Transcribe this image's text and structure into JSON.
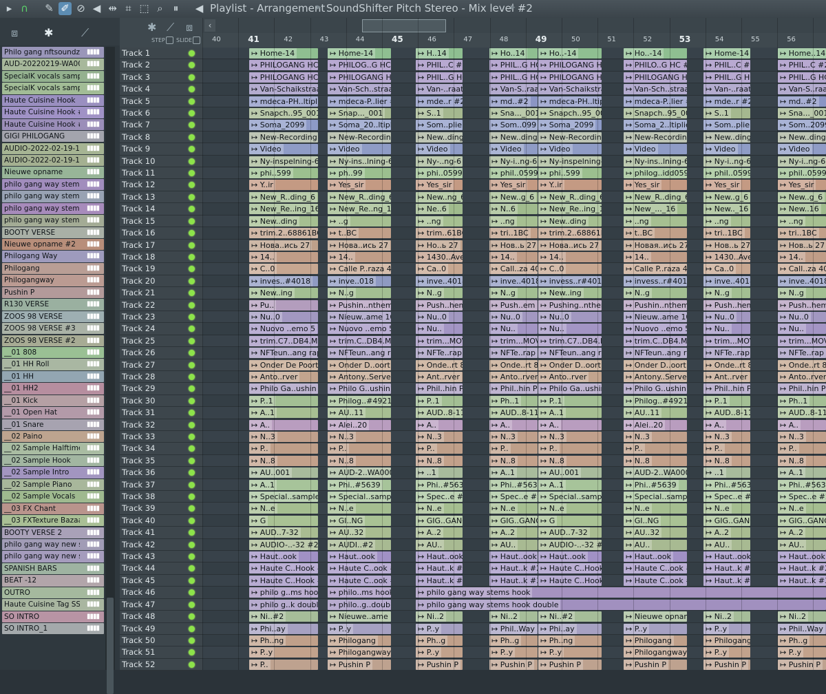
{
  "window": {
    "title": "Playlist - Arrangement",
    "breadcrumb": "SoundShifter Pitch Stereo - Mix level #2"
  },
  "toolbar": {
    "icons": [
      "magnet-icon",
      "pencil-icon",
      "paint-brush-icon",
      "delete-icon",
      "mute-icon",
      "slip-icon",
      "slice-icon",
      "select-icon",
      "zoom-icon",
      "playback-icon"
    ],
    "step_label": "STEP",
    "slide_label": "SLIDE"
  },
  "ruler": {
    "bars": [
      "40",
      "41",
      "42",
      "43",
      "44",
      "45",
      "46",
      "47",
      "48",
      "49",
      "50",
      "51",
      "52",
      "53",
      "54",
      "55",
      "56"
    ]
  },
  "clips": [
    {
      "name": "Philo gang nftsoundz#..",
      "color": "#9a96b9"
    },
    {
      "name": "AUD-20220219-WA0001",
      "color": "#a7b89b"
    },
    {
      "name": "SpecialK vocals sample",
      "color": "#94b18f"
    },
    {
      "name": "SpecialK vocals sample..",
      "color": "#a2bc96"
    },
    {
      "name": "Haute Cuisine Hook",
      "color": "#9a8fc0"
    },
    {
      "name": "Haute Cuisine Hook #2",
      "color": "#a092c6"
    },
    {
      "name": "Haute Cuisine Hook #3",
      "color": "#9b8eb9"
    },
    {
      "name": "GIGI PHILOGANG",
      "color": "#a3a4ad"
    },
    {
      "name": "AUDIO-2022-02-19-11..",
      "color": "#a6b493"
    },
    {
      "name": "AUDIO-2022-02-19-11..",
      "color": "#a4b091"
    },
    {
      "name": "Nieuwe opname",
      "color": "#98b598"
    },
    {
      "name": "philo gang way stems..",
      "color": "#a18dbd"
    },
    {
      "name": "philo gang way stems..",
      "color": "#98a2b3"
    },
    {
      "name": "philo gang way stems..",
      "color": "#a78bbb"
    },
    {
      "name": "philo gang way stems..",
      "color": "#a3ab95"
    },
    {
      "name": "BOOTY VERSE",
      "color": "#a9b0a6"
    },
    {
      "name": "Nieuwe opname #2",
      "color": "#b88e7a"
    },
    {
      "name": "Philogang Way",
      "color": "#9e9bbd"
    },
    {
      "name": "Philogang",
      "color": "#b99e95"
    },
    {
      "name": "Philogangway",
      "color": "#bb9b92"
    },
    {
      "name": "Pushin P",
      "color": "#b39a9a"
    },
    {
      "name": "R130 VERSE",
      "color": "#9ab0a0"
    },
    {
      "name": "ZOOS 98 VERSE",
      "color": "#9eafb2"
    },
    {
      "name": "ZOOS 98 VERSE #3",
      "color": "#aab2a6"
    },
    {
      "name": "ZOOS 98 VERSE #2",
      "color": "#a7ab94"
    },
    {
      "name": "__01 808",
      "color": "#9ac094"
    },
    {
      "name": "__01 HH Roll",
      "color": "#a9b7a2"
    },
    {
      "name": "__01 HH",
      "color": "#93a6b2"
    },
    {
      "name": "__01 HH2",
      "color": "#b68e9f"
    },
    {
      "name": "__01 Kick",
      "color": "#b5a0a4"
    },
    {
      "name": "__01 Open Hat",
      "color": "#b39aa9"
    },
    {
      "name": "__01 Snare",
      "color": "#a7a3b0"
    },
    {
      "name": "__02 Paino",
      "color": "#bda48f"
    },
    {
      "name": "__02 Sample Halftime",
      "color": "#a9bca2"
    },
    {
      "name": "__02 Sample Hook",
      "color": "#a2b6a1"
    },
    {
      "name": "__02 Sample Intro",
      "color": "#a295c0"
    },
    {
      "name": "__02 Sample Piano",
      "color": "#a8b79b"
    },
    {
      "name": "__02 Sample Vocals",
      "color": "#9fb98f"
    },
    {
      "name": "__03 FX Chant",
      "color": "#b9948c"
    },
    {
      "name": "__03 FXTexture Bazaar",
      "color": "#a9bf95"
    },
    {
      "name": "BOOTY VERSE 2",
      "color": "#a9a1b8"
    },
    {
      "name": "philo gang way new st..",
      "color": "#a19cb6"
    },
    {
      "name": "philo gang way new st..",
      "color": "#a59cbd"
    },
    {
      "name": "SPANISH BARS",
      "color": "#9eb3a1"
    },
    {
      "name": "BEAT -12",
      "color": "#b2a5aa"
    },
    {
      "name": "OUTRO",
      "color": "#a5b99e"
    },
    {
      "name": "Haute Cuisine Tag SSL",
      "color": "#a9b6a0"
    },
    {
      "name": "SO INTRO",
      "color": "#b894a4"
    },
    {
      "name": "SO INTRO_1",
      "color": "#a4a9ab"
    }
  ],
  "tracks": [
    {
      "name": "Track 1",
      "color": "#8fbf91",
      "labels": [
        "Home-14",
        "Home-14",
        "H..14",
        "Ho..14",
        "Ho..-14",
        "Ho..-14",
        "Home-14",
        "Home..14"
      ]
    },
    {
      "name": "Track 2",
      "color": "#a08cc2",
      "labels": [
        "PHILOGANG HC #2",
        "PHILOG..G HC #2",
        "PHIL..C #2",
        "PHIL..G HC #2",
        "PHILOGANG HC #2",
        "PHILO..G HC #2",
        "PHIL..C #2",
        "PHIL..C #2"
      ]
    },
    {
      "name": "Track 3",
      "color": "#9f8dc0",
      "labels": [
        "PHILOGANG HC",
        "PHILOGANG HC",
        "PHIL..G HC",
        "PHIL..G HC",
        "PHILOGANG HC",
        "PHILOGANG HC",
        "PHIL..G HC",
        "PHIL..G HC"
      ]
    },
    {
      "name": "Track 4",
      "color": "#9b90bf",
      "labels": [
        "Van-Schaikstraat",
        "Van-Sch..straat",
        "Van-..raat",
        "Van-S..raat",
        "Van-Schaikstraat",
        "Van-Sch..straat",
        "Van-..raat",
        "Van-S..raat"
      ]
    },
    {
      "name": "Track 5",
      "color": "#8b95c4",
      "labels": [
        "mdeca-PH..ltiplier",
        "mdeca-P..lier #2",
        "mde..r #2",
        "md..#2",
        "mdeca-PH..ltiplier",
        "mdeca-P..lier #2",
        "mde..r #2",
        "md..#2"
      ]
    },
    {
      "name": "Track 6",
      "color": "#a5b88f",
      "labels": [
        "Snapch..95_001",
        "Snap..._001",
        "S..1",
        "Sna..._001",
        "Snapch..95_001",
        "Snapch..95_001",
        "S..1",
        "Sna..._001"
      ]
    },
    {
      "name": "Track 7",
      "color": "#8d9ac7",
      "labels": [
        "Soma_2099",
        "Soma_20..ltiplier",
        "Som..plier",
        "Som..099",
        "Soma_2099",
        "Soma_2..ltiplier",
        "Som..plier",
        "Som..2099"
      ]
    },
    {
      "name": "Track 8",
      "color": "#a8b29c",
      "labels": [
        "New-Recording",
        "New-Recording",
        "New..ding",
        "New..ding",
        "New-Recording",
        "New-Recording",
        "New..ding",
        "New..ding"
      ]
    },
    {
      "name": "Track 9",
      "color": "#8f9cc6",
      "labels": [
        "Video",
        "Video",
        "Video",
        "Video",
        "Video",
        "Video",
        "Video",
        "Video"
      ]
    },
    {
      "name": "Track 10",
      "color": "#a7b896",
      "labels": [
        "Ny-inspelning-6",
        "Ny-ins..lning-6",
        "Ny-..ng-6",
        "Ny-i..ng-6",
        "Ny-inspelning-6",
        "Ny-ins..lning-6",
        "Ny-i..ng-6",
        "Ny-i..ng-6"
      ]
    },
    {
      "name": "Track 11",
      "color": "#9cc08f",
      "labels": [
        "phi..599",
        "ph..99",
        "phi..0599",
        "phil..0599",
        "phi..599",
        "philog..idd0599",
        "phil..0599",
        "phil..0599"
      ]
    },
    {
      "name": "Track 12",
      "color": "#c49a83",
      "labels": [
        "Y..ir",
        "Yes_sir",
        "Yes_sir",
        "Yes_sir",
        "Y..ir",
        "Yes_sir",
        "Yes_sir",
        "Yes_sir"
      ]
    },
    {
      "name": "Track 13",
      "color": "#a3bd8f",
      "labels": [
        "New_R..ding_6",
        "New_R..ding_6",
        "New..ng_6",
        "New..g_6",
        "New_R..ding_6",
        "New_R..ding_6",
        "New..g_6",
        "New..g_6"
      ]
    },
    {
      "name": "Track 14",
      "color": "#a0bb8d",
      "labels": [
        "New_Re..ing_16",
        "New_Re..ng_16",
        "Ne..6",
        "N..6",
        "New_Re..ing_16",
        "New_..._16",
        "New.._16",
        "New..16"
      ]
    },
    {
      "name": "Track 15",
      "color": "#a6bf91",
      "labels": [
        "New..ding",
        "..g",
        "..ng",
        "..ng",
        "New..ding",
        "..ng",
        "..ng",
        "..ng"
      ]
    },
    {
      "name": "Track 16",
      "color": "#c2a089",
      "labels": [
        "trim.2..68861BC",
        "t..BC",
        "trim..61BC",
        "tri..1BC",
        "trim.2..68861BC",
        "t..BC",
        "tri..1BC",
        "tri..1BC"
      ]
    },
    {
      "name": "Track 17",
      "color": "#bda08a",
      "labels": [
        "Нова..ись 27",
        "Нова..ись 27",
        "Но..ь 27",
        "Нов..ь 27",
        "Нова..ись 27",
        "Новая..ись 27",
        "Нов..ь 27",
        "Нов..ь 27"
      ]
    },
    {
      "name": "Track 18",
      "color": "#c09d88",
      "labels": [
        "14..",
        "14..",
        "1430..Ave",
        "14..",
        "14..",
        "14..",
        "1430..Ave",
        "14.."
      ]
    },
    {
      "name": "Track 19",
      "color": "#c7a791",
      "labels": [
        "C..0",
        "Calle P..raza 40",
        "Ca..0",
        "Call..za 40",
        "C..0",
        "Calle P..raza 40",
        "Ca..0",
        "Call..za 40"
      ]
    },
    {
      "name": "Track 20",
      "color": "#8f9ac2",
      "labels": [
        "inves..#4018",
        "inve..018",
        "inve..4018",
        "inve..4018",
        "invess..r#4018",
        "invess..r#4018",
        "inve..4018",
        "inve..4018"
      ]
    },
    {
      "name": "Track 21",
      "color": "#a3bf92",
      "labels": [
        "New..ing",
        "N..g",
        "N..g",
        "N..g",
        "New..ing",
        "N..g",
        "N..g",
        "N..g"
      ]
    },
    {
      "name": "Track 22",
      "color": "#b39dbd",
      "labels": [
        "Pu..",
        "Pushin..nthem",
        "Push..hem",
        "Push..em",
        "Pushing..nthem",
        "Pushin..nthem",
        "Push..hem",
        "Push..hem"
      ]
    },
    {
      "name": "Track 23",
      "color": "#a298c1",
      "labels": [
        "Nu..0",
        "Nieuw..ame 10",
        "Nu..0",
        "Nu..0",
        "Nu..0",
        "Nieuw..ame 10",
        "Nu..0",
        "Nu..0"
      ]
    },
    {
      "name": "Track 24",
      "color": "#a395c4",
      "labels": [
        "Nuovo ..emo 5",
        "Nuovo ..emo 5",
        "Nu..",
        "Nu..",
        "Nu..",
        "Nuovo ..emo 5",
        "Nu..",
        "Nu.."
      ]
    },
    {
      "name": "Track 25",
      "color": "#a595c3",
      "labels": [
        "trim.C7..DB4.MOV",
        "trim.C..DB4.MOV",
        "trim...MOV",
        "trim...MOV",
        "trim.C7..DB4.MOV",
        "trim.C..DB4.MOV",
        "trim...MOV",
        "trim...MOV"
      ]
    },
    {
      "name": "Track 26",
      "color": "#a59ac0",
      "labels": [
        "NFTeun..ang rap",
        "NFTeun..ang rap",
        "NFTe..rap",
        "NFTe..rap",
        "NFTeun..ang rap",
        "NFTeun..ang rap",
        "NFTe..rap",
        "NFTe..rap"
      ]
    },
    {
      "name": "Track 27",
      "color": "#c3a48b",
      "labels": [
        "Onder De Poort 8",
        "Onder D..oort 8",
        "Onde..rt 8",
        "Onde..rt 8",
        "Onder D..oort 8",
        "Onder D..oort 8",
        "Onde..rt 8",
        "Onde..rt 8"
      ]
    },
    {
      "name": "Track 28",
      "color": "#c2a48e",
      "labels": [
        "Anto..rver",
        "Antony..Server",
        "Ant..rver",
        "Anto..rver",
        "Anto..rver",
        "Antony..Server",
        "Ant..rver",
        "Anto..rver"
      ]
    },
    {
      "name": "Track 29",
      "color": "#a99bc1",
      "labels": [
        "Philo Ga..ushin P",
        "Philo G..ushin P",
        "Phil..hin P",
        "Phil..hin P",
        "Philo Ga..ushin P",
        "Philo G..ushin P",
        "Phil..hin P",
        "Phil..hin P"
      ]
    },
    {
      "name": "Track 30",
      "color": "#a3bf94",
      "labels": [
        "P..1",
        "Philog..#4921",
        "P..1",
        "Ph..1",
        "P..1",
        "Philog..#4921",
        "P..1",
        "Ph..1"
      ]
    },
    {
      "name": "Track 31",
      "color": "#a7bf92",
      "labels": [
        "A..1",
        "AU..11",
        "AUD..8-11",
        "AUD..8-11",
        "A..1",
        "AU..11",
        "AUD..8-11",
        "AUD..8-11"
      ]
    },
    {
      "name": "Track 32",
      "color": "#b99dbf",
      "labels": [
        "A..",
        "Alei..20",
        "A..",
        "A..",
        "A..",
        "Alei..20",
        "A..",
        "A.."
      ]
    },
    {
      "name": "Track 33",
      "color": "#c0a08c",
      "labels": [
        "N..3",
        "N..3",
        "N..3",
        "N..3",
        "N..3",
        "N..3",
        "N..3",
        "N..3"
      ]
    },
    {
      "name": "Track 34",
      "color": "#bf9f89",
      "labels": [
        "P..",
        "P..",
        "P..",
        "P..",
        "P..",
        "P..",
        "P..",
        "P.."
      ]
    },
    {
      "name": "Track 35",
      "color": "#c3a18b",
      "labels": [
        "N..8",
        "N..8",
        "N..8",
        "N..8",
        "N..8",
        "N..8",
        "N..8",
        "N..8"
      ]
    },
    {
      "name": "Track 36",
      "color": "#a8bb9c",
      "labels": [
        "AU..001",
        "AUD-2..WA0001",
        "..1",
        "A..1",
        "AU..001",
        "AUD-2..WA0001",
        "..1",
        "A..1"
      ]
    },
    {
      "name": "Track 37",
      "color": "#a7c49a",
      "labels": [
        "A..1",
        "Phi..#5639",
        "Phi..#5639",
        "Phi..#5639",
        "A..1",
        "Phi..#5639",
        "Phi..#5639",
        "Phi..#5639"
      ]
    },
    {
      "name": "Track 38",
      "color": "#a9c49c",
      "labels": [
        "Special..sample",
        "Special..sample",
        "Spec..e #2",
        "Spec..e #2",
        "Special..sample",
        "Special..sample",
        "Spec..e #2",
        "Spec..e #2"
      ]
    },
    {
      "name": "Track 39",
      "color": "#a5be90",
      "labels": [
        "N..e",
        "N..e",
        "N..e",
        "N..e",
        "N..e",
        "N..e",
        "N..e",
        "N..e"
      ]
    },
    {
      "name": "Track 40",
      "color": "#a9c294",
      "labels": [
        "G",
        "GI..NG",
        "GIG..GANG",
        "GIG..GANG",
        "G",
        "GI..NG",
        "GIG..GANG",
        "GIG..GANG"
      ]
    },
    {
      "name": "Track 41",
      "color": "#a9bc91",
      "labels": [
        "AUD..7-32",
        "AU..32",
        "A..2",
        "A..2",
        "AUD..7-32",
        "AU..32",
        "A..2",
        "A..2"
      ]
    },
    {
      "name": "Track 42",
      "color": "#a8ba92",
      "labels": [
        "AUDIO-..-32 #2",
        "AUDI..#2",
        "AU..",
        "AU..",
        "AUDIO-..-32 #2",
        "AU..",
        "AU..",
        "AU.."
      ]
    },
    {
      "name": "Track 43",
      "color": "#a191c5",
      "labels": [
        "Haut..ook",
        "Haut..ook",
        "Haut..ook",
        "Haut..ook",
        "Haut..ook",
        "Haut..ook",
        "Haut..ook",
        "Haut..ook"
      ]
    },
    {
      "name": "Track 44",
      "color": "#a595c6",
      "labels": [
        "Haute C..Hook #2",
        "Haute C..ook #2",
        "Haut..k #2",
        "Haut..k #2",
        "Haute C..Hook #2",
        "Haute C..ook #2",
        "Haut..k #2",
        "Haut..k #2"
      ]
    },
    {
      "name": "Track 45",
      "color": "#a091c3",
      "labels": [
        "Haute C..Hook #3",
        "Haute C..ook #3",
        "Haut..k #3",
        "Haut..k #3",
        "Haute C..Hook #3",
        "Haute C..ook #3",
        "Haut..k #3",
        "Haut..k #3"
      ]
    },
    {
      "name": "Track 46",
      "color": "#a693c0",
      "labels": [
        "philo g..ms hook",
        "philo..ms hook",
        "philo gang way stems hook"
      ]
    },
    {
      "name": "Track 47",
      "color": "#a190bf",
      "labels": [
        "philo g..k double",
        "philo..g..double",
        "philo gang way stems hook double"
      ]
    },
    {
      "name": "Track 48",
      "color": "#a6bd99",
      "labels": [
        "Ni..#2",
        "Nieuwe..ame #2",
        "Ni..2",
        "Ni..2",
        "Ni..#2",
        "Nieuwe opname #2",
        "Ni..2",
        "Ni..2"
      ]
    },
    {
      "name": "Track 49",
      "color": "#a6a1c2",
      "labels": [
        "Phi..ay",
        "P..y",
        "P..y",
        "Phil..Way",
        "Phi..ay",
        "P..y",
        "P..y",
        "Phil..Way"
      ]
    },
    {
      "name": "Track 50",
      "color": "#c0a08a",
      "labels": [
        "Ph..ng",
        "Philogang",
        "Ph..g",
        "Ph..g",
        "Ph..ng",
        "Philogang",
        "Philogang",
        "Ph..g"
      ]
    },
    {
      "name": "Track 51",
      "color": "#c2a28c",
      "labels": [
        "P..y",
        "Philogangway",
        "P..y",
        "P..y",
        "P..y",
        "Philogangway",
        "P..y",
        "P..y"
      ]
    },
    {
      "name": "Track 52",
      "color": "#bea28f",
      "labels": [
        "P..",
        "Pushin P",
        "Pushin P",
        "Pushin P",
        "Pushin P",
        "Pushin P",
        "Pushin P",
        "Pushin P"
      ]
    }
  ]
}
